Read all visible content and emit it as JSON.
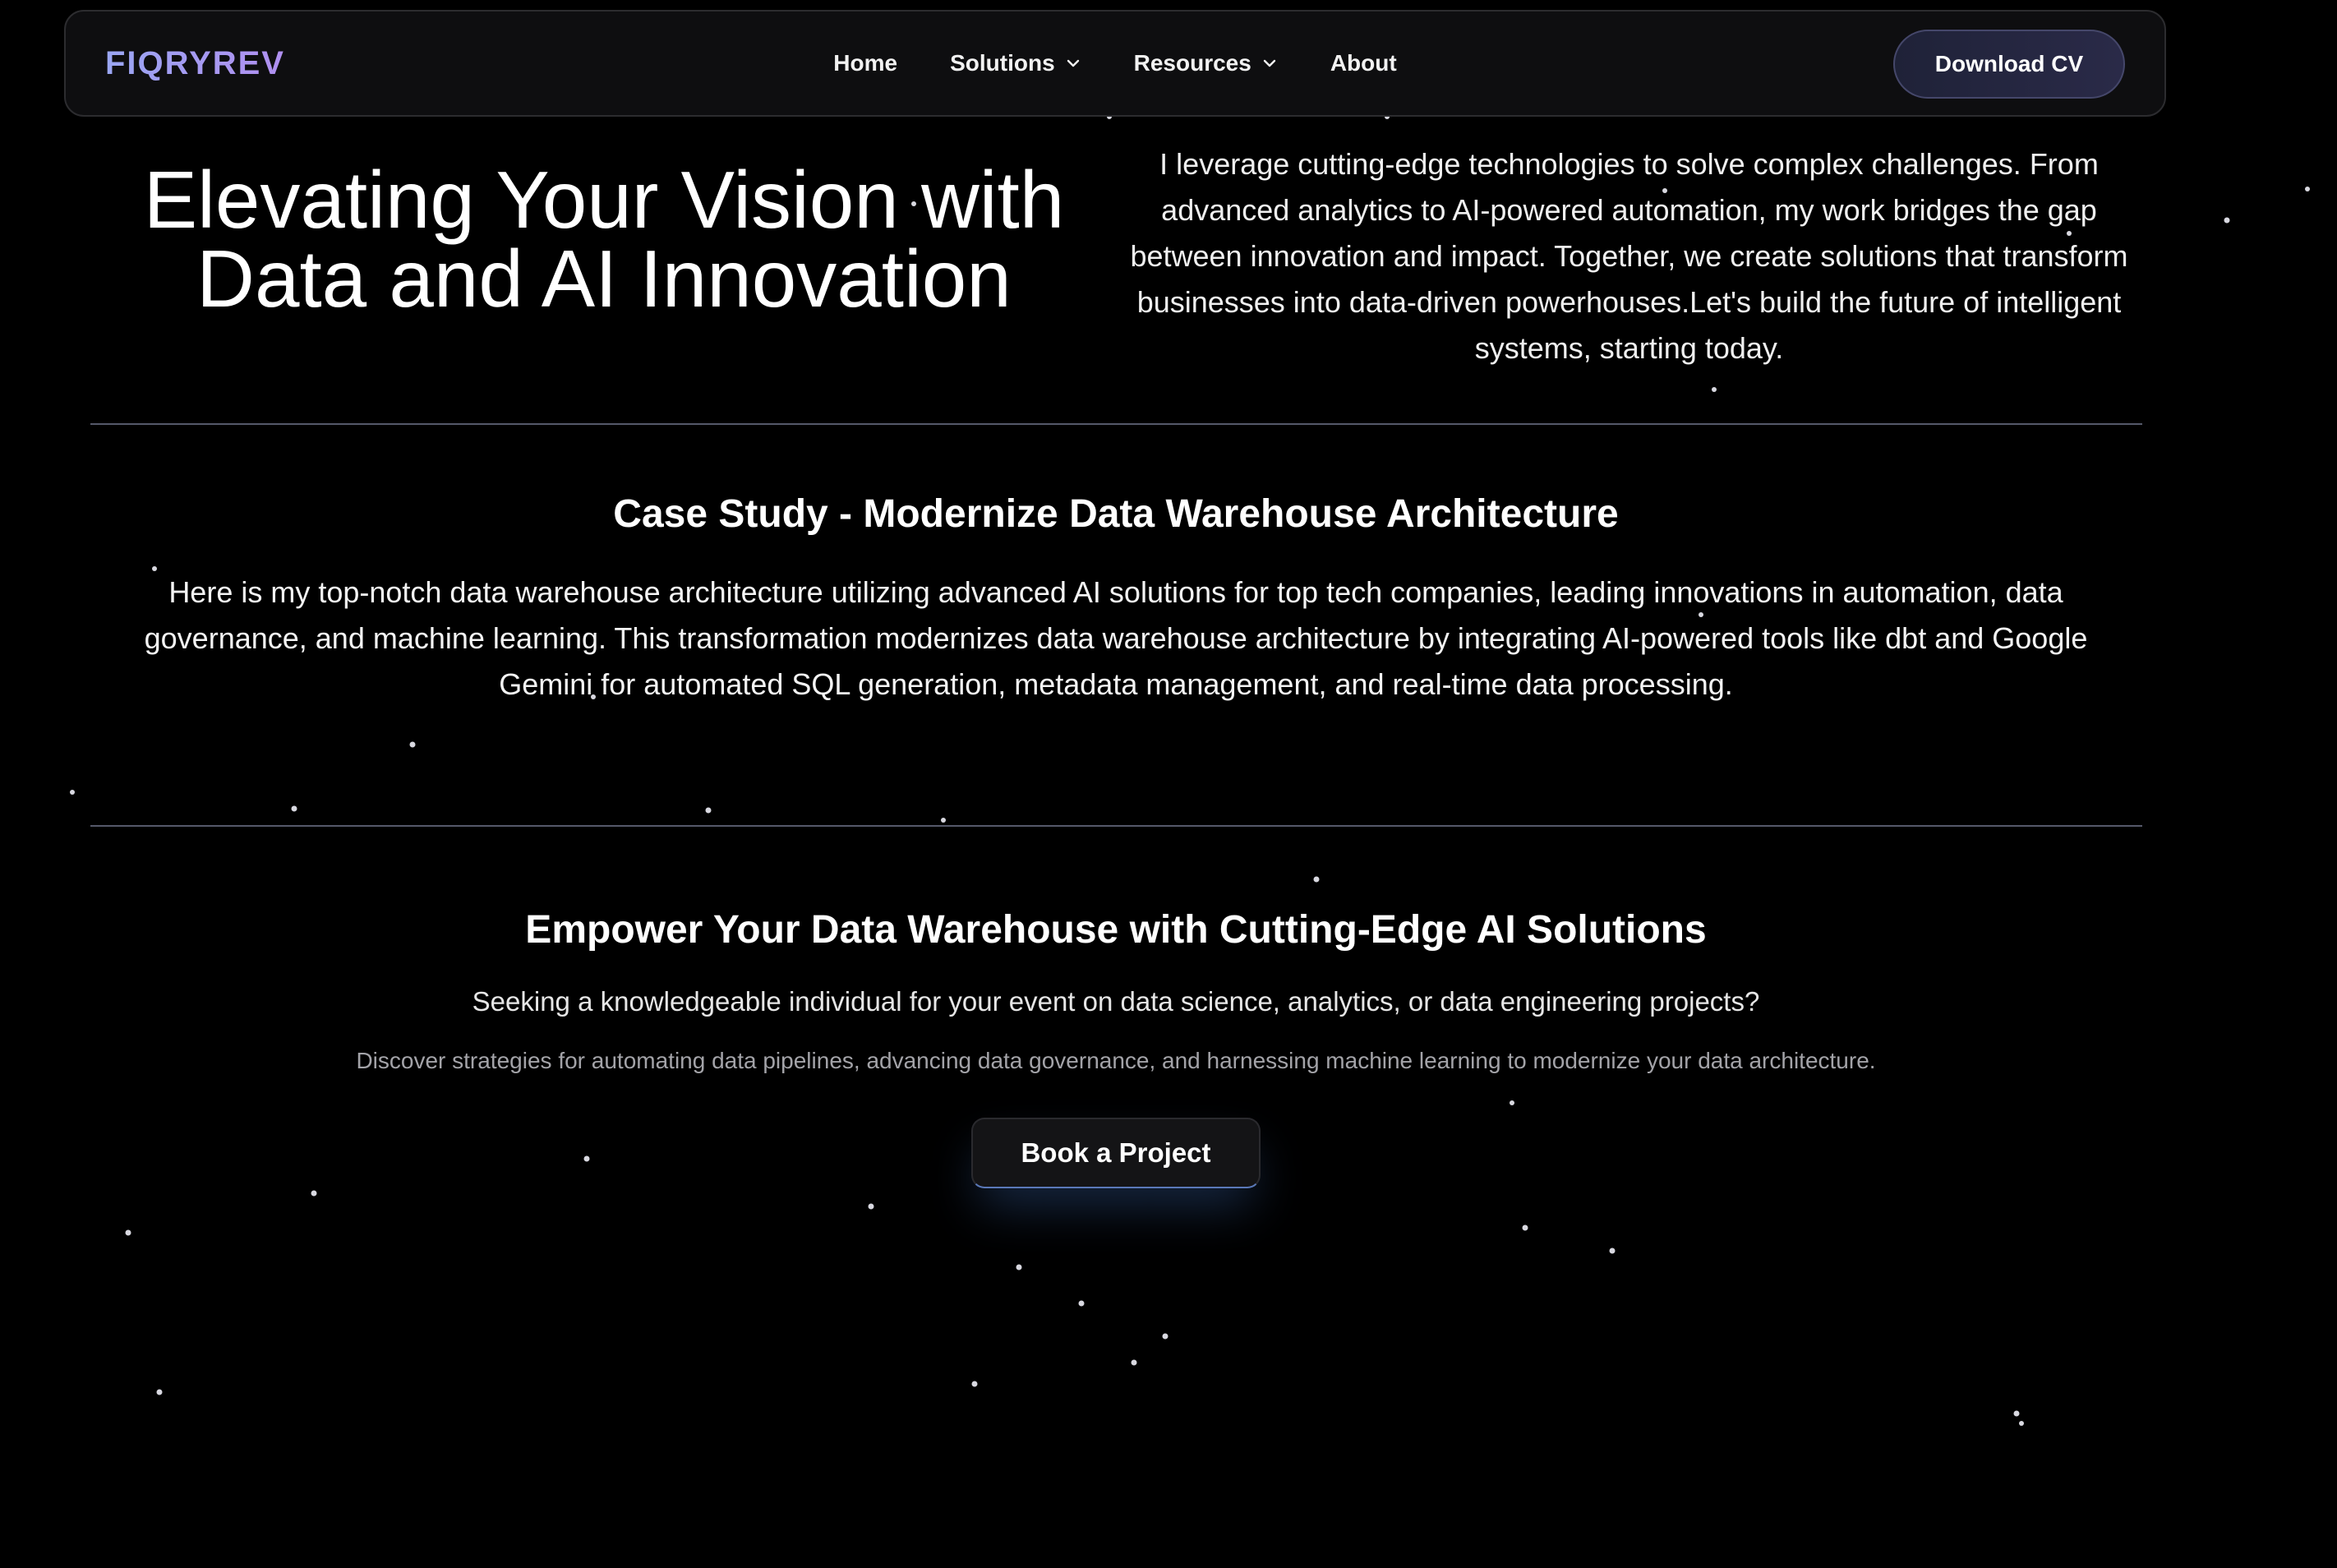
{
  "nav": {
    "brand": "FIQRYREV",
    "links": [
      {
        "label": "Home",
        "has_dropdown": false
      },
      {
        "label": "Solutions",
        "has_dropdown": true
      },
      {
        "label": "Resources",
        "has_dropdown": true
      },
      {
        "label": "About",
        "has_dropdown": false
      }
    ],
    "cta": "Download CV"
  },
  "hero": {
    "title_line1": "Elevating Your Vision with",
    "title_line2": "Data and AI Innovation",
    "description": "I leverage cutting-edge technologies to solve complex challenges. From advanced analytics to AI-powered automation, my work bridges the gap between innovation and impact. Together, we create solutions that transform businesses into data-driven powerhouses.Let's build the future of intelligent systems, starting today."
  },
  "case_study": {
    "title": "Case Study - Modernize Data Warehouse Architecture",
    "body": "Here is my top-notch data warehouse architecture utilizing advanced AI solutions for top tech companies, leading innovations in automation, data governance, and machine learning. This transformation modernizes data warehouse architecture by integrating AI-powered tools like dbt and Google Gemini for automated SQL generation, metadata management, and real-time data processing."
  },
  "cta": {
    "title": "Empower Your Data Warehouse with Cutting-Edge AI Solutions",
    "subtitle": "Seeking a knowledgeable individual for your event on data science, analytics, or data engineering projects?",
    "detail": "Discover strategies for automating data pipelines, advancing data governance, and harnessing machine learning to modernize your data architecture.",
    "button": "Book a Project"
  },
  "colors": {
    "background": "#000000",
    "brand_gradient_start": "#9aa6f3",
    "brand_gradient_end": "#b08ff0",
    "divider": "#55596a",
    "button_glow": "#4678c8"
  },
  "icons": {
    "dropdown": "chevron-down-icon",
    "background": "starfield"
  }
}
